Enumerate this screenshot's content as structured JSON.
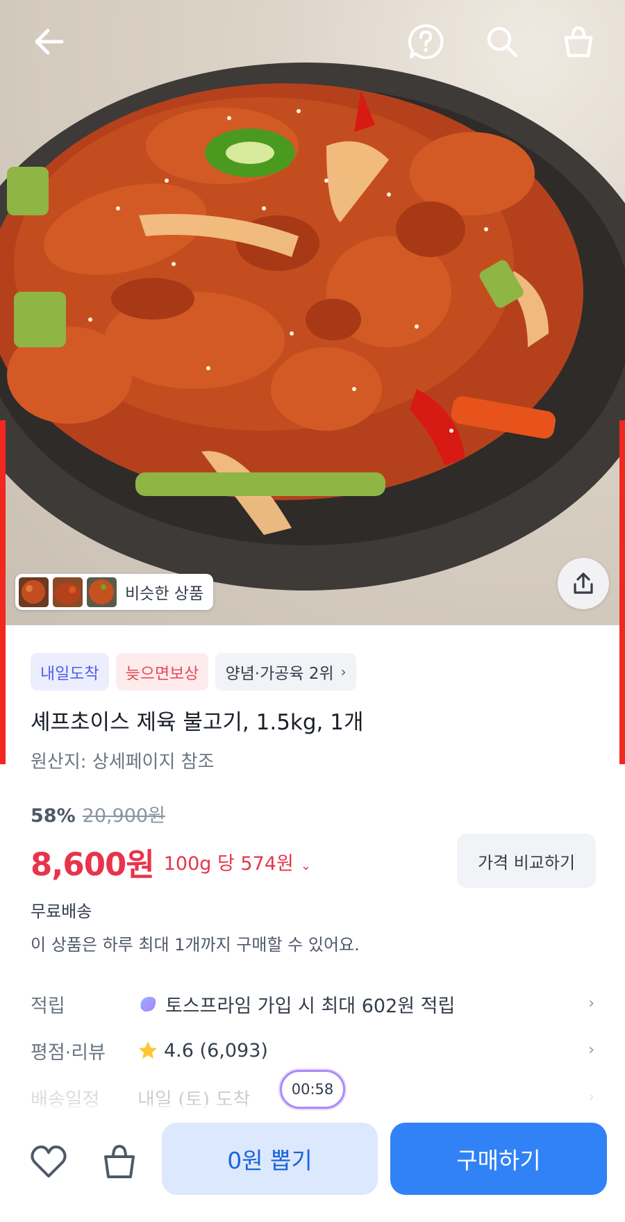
{
  "header": {
    "icons": [
      "back-arrow-icon",
      "help-icon",
      "search-icon",
      "shopping-bag-icon"
    ]
  },
  "hero": {
    "similar_label": "비슷한 상품",
    "share_icon": "share-icon"
  },
  "badges": {
    "tomorrow": "내일도착",
    "late_comp": "늦으면보상",
    "rank": "양념·가공육 2위",
    "rank_chevron": "›"
  },
  "product": {
    "title": "셰프초이스 제육 불고기, 1.5kg, 1개",
    "origin": "원산지: 상세페이지 참조"
  },
  "pricing": {
    "discount": "58%",
    "original_price": "20,900원",
    "price": "8,600원",
    "unit_price": "100g 당 574원",
    "unit_chevron": "⌄",
    "compare_button": "가격 비교하기",
    "shipping": "무료배송",
    "limit_notice": "이 상품은 하루 최대 1개까지 구매할 수 있어요."
  },
  "info_rows": {
    "points": {
      "label": "적립",
      "value": "토스프라임 가입 시 최대 602원 적립"
    },
    "review": {
      "label": "평점·리뷰",
      "rating": "4.6",
      "count": "(6,093)"
    },
    "delivery": {
      "label": "배송일정",
      "value": "내일 (토) 도착"
    },
    "arrow": "›"
  },
  "timer": "00:58",
  "bottom_bar": {
    "draw_button": "0원 뽑기",
    "buy_button": "구매하기",
    "icons": [
      "heart-icon",
      "bag-icon"
    ]
  },
  "colors": {
    "price_red": "#e8344a",
    "primary_blue": "#3182f6",
    "light_blue": "#dbe8fd",
    "badge_blue": "#4e5fe8",
    "badge_red": "#e64a56"
  }
}
